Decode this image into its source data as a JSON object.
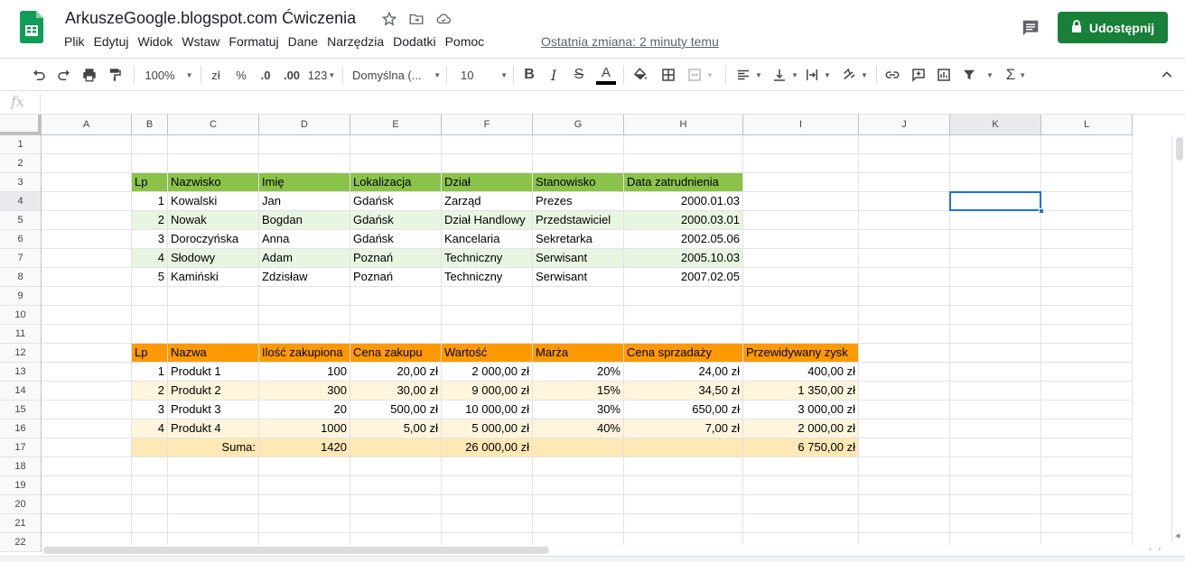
{
  "app": {
    "title": "ArkuszeGoogle.blogspot.com Ćwiczenia",
    "last_edit": "Ostatnia zmiana: 2 minuty temu",
    "share_label": "Udostępnij",
    "accent": "#188038"
  },
  "menu": [
    "Plik",
    "Edytuj",
    "Widok",
    "Wstaw",
    "Formatuj",
    "Dane",
    "Narzędzia",
    "Dodatki",
    "Pomoc"
  ],
  "toolbar": {
    "zoom": "100%",
    "currency": "zł",
    "percent": "%",
    "dec_less": ".0",
    "dec_more": ".00",
    "more_formats": "123",
    "font": "Domyślna (...",
    "font_size": "10"
  },
  "formula_bar": {
    "fx_label": "fx",
    "value": ""
  },
  "columns": [
    "A",
    "B",
    "C",
    "D",
    "E",
    "F",
    "G",
    "H",
    "I",
    "J",
    "K",
    "L"
  ],
  "rows": [
    "1",
    "2",
    "3",
    "4",
    "5",
    "6",
    "7",
    "8",
    "9",
    "10",
    "11",
    "12",
    "13",
    "14",
    "15",
    "16",
    "17",
    "18",
    "19",
    "20",
    "21",
    "22"
  ],
  "selected_cell": "K4",
  "colors": {
    "green_header": "#8bc34a",
    "green_band": "#e8f5e0",
    "orange_header": "#ff9900",
    "orange_band": "#fff5dc",
    "orange_total": "#fde8b6"
  },
  "employees": {
    "headers": [
      "Lp",
      "Nazwisko",
      "Imię",
      "Lokalizacja",
      "Dział",
      "Stanowisko",
      "Data zatrudnienia"
    ],
    "rows": [
      [
        "1",
        "Kowalski",
        "Jan",
        "Gdańsk",
        "Zarząd",
        "Prezes",
        "2000.01.03"
      ],
      [
        "2",
        "Nowak",
        "Bogdan",
        "Gdańsk",
        "Dział Handlowy",
        "Przedstawiciel",
        "2000.03.01"
      ],
      [
        "3",
        "Doroczyńska",
        "Anna",
        "Gdańsk",
        "Kancelaria",
        "Sekretarka",
        "2002.05.06"
      ],
      [
        "4",
        "Słodowy",
        "Adam",
        "Poznań",
        "Techniczny",
        "Serwisant",
        "2005.10.03"
      ],
      [
        "5",
        "Kamiński",
        "Zdzisław",
        "Poznań",
        "Techniczny",
        "Serwisant",
        "2007.02.05"
      ]
    ]
  },
  "products": {
    "headers": [
      "Lp",
      "Nazwa",
      "Ilość zakupiona",
      "Cena zakupu",
      "Wartość",
      "Marża",
      "Cena sprzadaży",
      "Przewidywany zysk"
    ],
    "rows": [
      [
        "1",
        "Produkt 1",
        "100",
        "20,00 zł",
        "2 000,00 zł",
        "20%",
        "24,00 zł",
        "400,00 zł"
      ],
      [
        "2",
        "Produkt 2",
        "300",
        "30,00 zł",
        "9 000,00 zł",
        "15%",
        "34,50 zł",
        "1 350,00 zł"
      ],
      [
        "3",
        "Produkt 3",
        "20",
        "500,00 zł",
        "10 000,00 zł",
        "30%",
        "650,00 zł",
        "3 000,00 zł"
      ],
      [
        "4",
        "Produkt 4",
        "1000",
        "5,00 zł",
        "5 000,00 zł",
        "40%",
        "7,00 zł",
        "2 000,00 zł"
      ]
    ],
    "total": [
      "",
      "Suma:",
      "1420",
      "",
      "26 000,00 zł",
      "",
      "",
      "6 750,00 zł"
    ]
  }
}
